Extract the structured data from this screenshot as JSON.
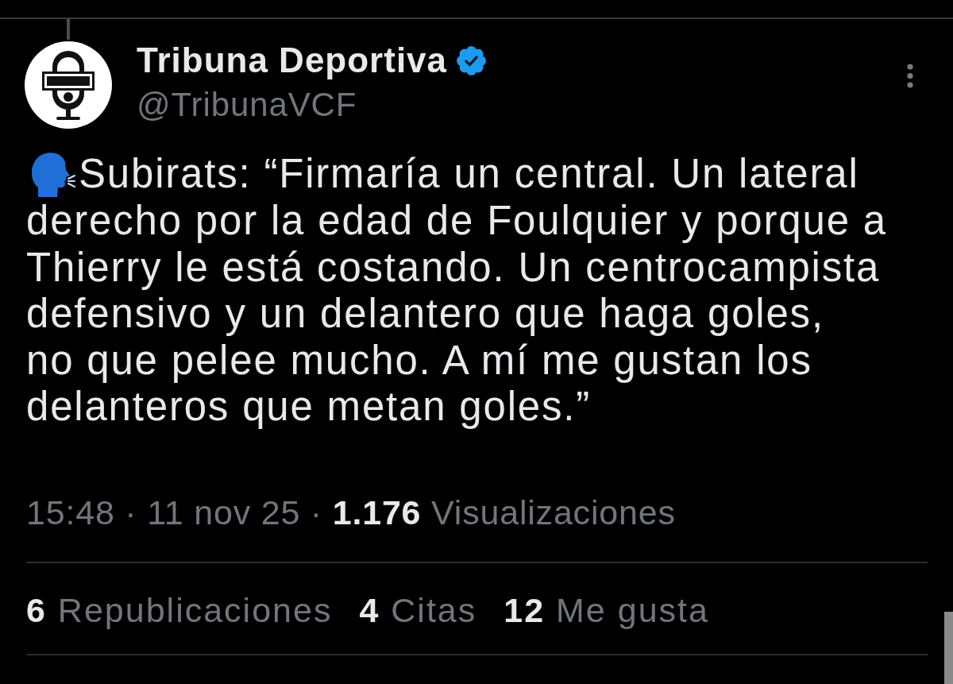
{
  "tweet": {
    "author": {
      "name": "Tribuna Deportiva",
      "verified": true,
      "handle": "@TribunaVCF"
    },
    "text_lines": [
      "Subirats: “Firmaría un central. Un lateral",
      "derecho por la edad de Foulquier y porque a",
      "Thierry le está costando. Un centrocampista",
      "defensivo y un delantero que haga goles,",
      "no que pelee mucho. A mí me gustan los",
      "delanteros que metan goles.”"
    ],
    "meta": "15:48 · 11 nov 25 · **1.176** Visualizaciones",
    "stats": [
      "**6** Republicaciones",
      "**4** Citas",
      "**12** Me gusta"
    ]
  }
}
